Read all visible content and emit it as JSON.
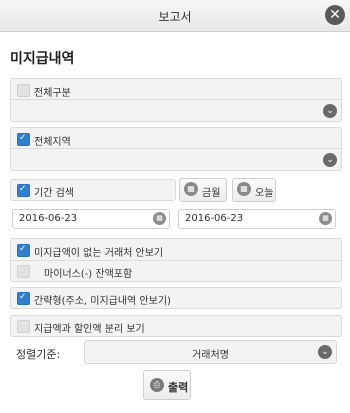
{
  "window": {
    "title": "보고서"
  },
  "heading": "미지급내역",
  "all_category": {
    "label": "전체구분",
    "checked": false,
    "select_value": ""
  },
  "all_region": {
    "label": "전체지역",
    "checked": true,
    "select_value": ""
  },
  "period": {
    "label": "기간 검색",
    "checked": true,
    "month_button": "금월",
    "today_button": "오늘",
    "start_date": "2016-06-23",
    "end_date": "2016-06-23"
  },
  "options": {
    "hide_no_unpaid": {
      "label": "미지급액이 없는 거래처 안보기",
      "checked": true
    },
    "include_minus": {
      "label": "마이너스(-) 잔액포함",
      "checked": false
    },
    "simple_mode": {
      "label": "간략형(주소, 미지급내역 안보기)",
      "checked": true
    },
    "separate_view": {
      "label": "지급액과 할인액 분리 보기",
      "checked": false
    }
  },
  "sort": {
    "label": "정렬기준:",
    "value": "거래처명"
  },
  "print_button": "출력",
  "icons": {
    "close": "close-icon",
    "chevron": "chevron-down-icon",
    "calendar": "calendar-icon",
    "print": "print-icon"
  },
  "colors": {
    "check_blue": "#2f7fd1",
    "panel_bg": "#f3f3f3"
  }
}
